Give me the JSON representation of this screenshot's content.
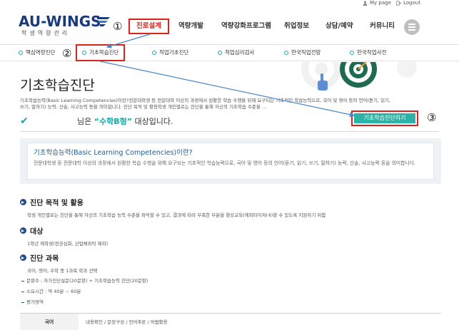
{
  "util": {
    "mypage": "My page",
    "logout": "Logout"
  },
  "logo": {
    "text": "AU-WINGS",
    "sub": "학생역량관리"
  },
  "markers": {
    "m1": "①",
    "m2": "②",
    "m3": "③"
  },
  "nav": [
    {
      "label": "진로설계",
      "active": true
    },
    {
      "label": "역량개발"
    },
    {
      "label": "역량강화프로그램"
    },
    {
      "label": "취업정보"
    },
    {
      "label": "상담/예약"
    },
    {
      "label": "커뮤니티"
    }
  ],
  "subnav": [
    {
      "label": "핵심역량진단"
    },
    {
      "label": "기초학습진단",
      "active": true
    },
    {
      "label": "직업기초진단"
    },
    {
      "label": "직업심리검사"
    },
    {
      "label": "한국직업전망"
    },
    {
      "label": "한국직업사전"
    }
  ],
  "page": {
    "title": "기초학습진단",
    "intro": "기초학습능력(Basic Learning Competencies)이란?전문대학생 등 전문대학 이상의 과정에서 원활한 학습 수행을 위해 요구되는 기초적인 학습능력으로, 국어 및 영어 등의 언어(듣기, 읽기, 쓰기, 말하기) 능력, 산술, 사고능력 등을 의미합니다. 진단 목적 및 활용학생 개인별로는 진단을 통해 자신의 기초학습 수준을 …"
  },
  "result": {
    "prefix": "님은 ",
    "highlight": "“수학B형”",
    "suffix": " 대상입니다.",
    "cta": "기초학습진단하기"
  },
  "infobox": {
    "title": "기초학습능력(Basic Learning Competencies)이란?",
    "body": "전문대학생 등 전문대학 이상의 과정에서 원활한 학습 수행을 위해 요구되는 기초적인 학습능력으로, 국어 및 영어 등의 언어(듣기, 읽기, 쓰기, 말하기) 능력, 산술, 사고능력 등을 의미합니다."
  },
  "sections": {
    "purpose": {
      "title": "진단 목적 및 활용",
      "body": "학생 개인별로는 진단을 통해 자신의 기초학습 능력 수준을 파악할 수 있고, 결과에 따라 부족한 부분을 향상교육(에피타이저Ⅰ·Ⅱ)할 수 있도록 지원하기 위함"
    },
    "target": {
      "title": "대상",
      "body": "1학년 재학생(전공심화, 산업체위탁 제외)"
    },
    "course": {
      "title": "진단 과목",
      "body": "국어, 영어, 수학 중 1과목 학과 선택",
      "items": [
        "문항수 : 자가진단설문(20문항) + 기초학습능력 진단(20문항)",
        "소요시간 : 약 40분 ~ 60분",
        "평가영역"
      ]
    }
  },
  "table": {
    "header": "국어",
    "cell": "내용확인 / 문장구성 / 언어추론 / 어법활용"
  },
  "colors": {
    "accent": "#1aa7a7",
    "highlight": "#d9231d",
    "brand": "#1b3a7a",
    "button": "#2ab3a6"
  }
}
